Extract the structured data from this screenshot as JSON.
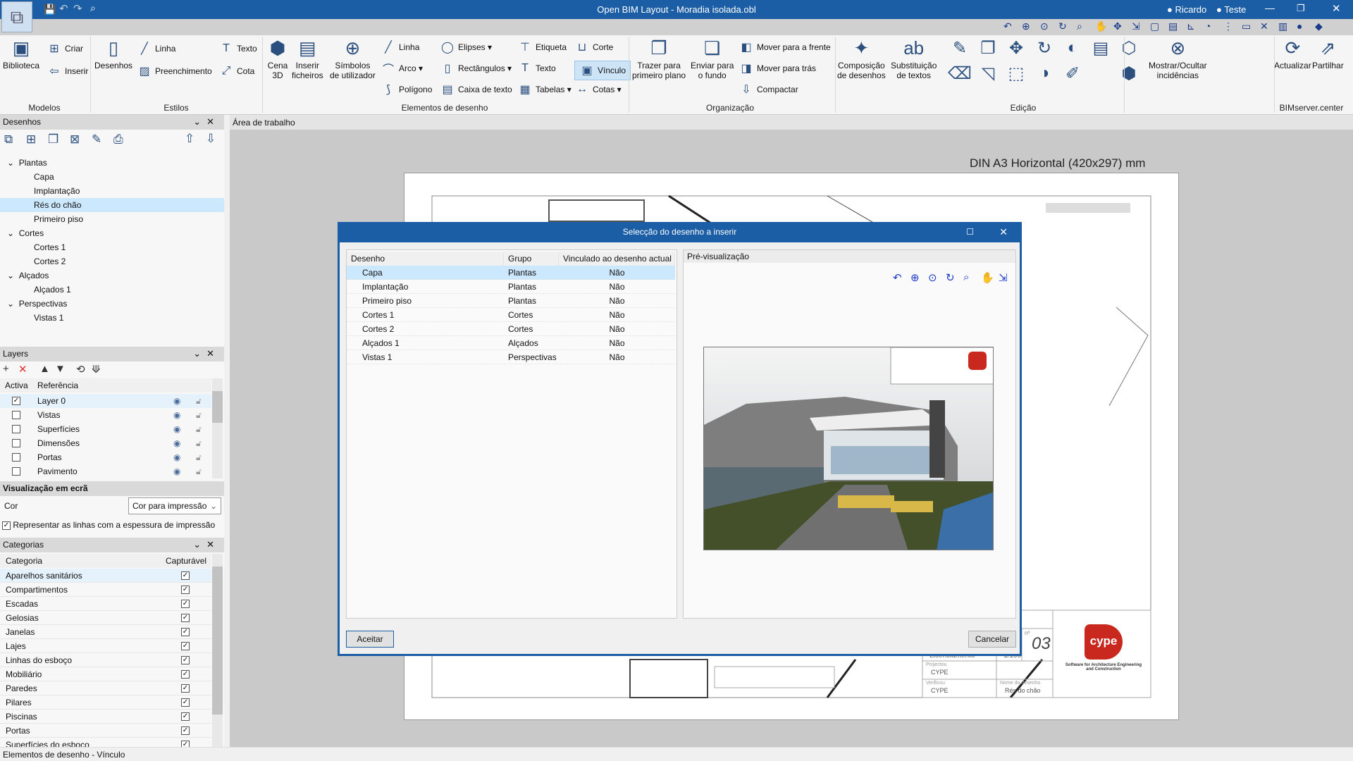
{
  "window": {
    "title": "Open BIM Layout - Moradia isolada.obl",
    "user1": "Ricardo",
    "user2": "Teste"
  },
  "ribbon": {
    "groups": [
      "Modelos",
      "Estilos",
      "Elementos de desenho",
      "Organização",
      "Edição",
      "BIMserver.center"
    ],
    "items": {
      "biblioteca": "Biblioteca",
      "criar": "Criar",
      "inserir": "Inserir",
      "desenhos": "Desenhos",
      "linha_estilo": "Linha",
      "preenchimento": "Preenchimento",
      "texto_estilo": "Texto",
      "cota": "Cota",
      "cena3d": "Cena\n3D",
      "inserir_ficheiros": "Inserir\nficheiros",
      "simbolos": "Símbolos\nde utilizador",
      "linha": "Linha",
      "arco": "Arco ▾",
      "poligono": "Polígono",
      "elipses": "Elipses ▾",
      "rectangulos": "Rectângulos ▾",
      "caixa_texto": "Caixa de texto",
      "etiqueta": "Etiqueta",
      "texto": "Texto",
      "tabelas": "Tabelas ▾",
      "corte": "Corte",
      "vinculo": "Vínculo",
      "cotas": "Cotas ▾",
      "trazer": "Trazer para\nprimeiro plano",
      "enviar": "Enviar para\no fundo",
      "mover_frente": "Mover para a frente",
      "mover_tras": "Mover para trás",
      "compactar": "Compactar",
      "composicao": "Composição\nde desenhos",
      "substituicao": "Substituição\nde textos",
      "mostrar": "Mostrar/Ocultar\nincidências",
      "actualizar": "Actualizar",
      "partilhar": "Partilhar"
    },
    "active_item": "vinculo"
  },
  "desenhos_panel": {
    "title": "Desenhos",
    "tree": [
      {
        "group": "Plantas",
        "items": [
          "Capa",
          "Implantação",
          "Rés do chão",
          "Primeiro piso"
        ]
      },
      {
        "group": "Cortes",
        "items": [
          "Cortes 1",
          "Cortes 2"
        ]
      },
      {
        "group": "Alçados",
        "items": [
          "Alçados 1"
        ]
      },
      {
        "group": "Perspectivas",
        "items": [
          "Vistas 1"
        ]
      }
    ],
    "selected": "Rés do chão"
  },
  "layers_panel": {
    "title": "Layers",
    "columns": [
      "Activa",
      "Referência"
    ],
    "rows": [
      {
        "name": "Layer 0",
        "active": true
      },
      {
        "name": "Vistas",
        "active": false
      },
      {
        "name": "Superfícies",
        "active": false
      },
      {
        "name": "Dimensões",
        "active": false
      },
      {
        "name": "Portas",
        "active": false
      },
      {
        "name": "Pavimento",
        "active": false
      }
    ]
  },
  "visualizacao": {
    "title": "Visualização em ecrã",
    "color_label": "Cor",
    "color_value": "Cor para impressão",
    "checkbox_label": "Representar as linhas com a espessura de impressão",
    "checkbox_checked": true
  },
  "categorias_panel": {
    "title": "Categorias",
    "columns": [
      "Categoria",
      "Capturável"
    ],
    "rows": [
      "Aparelhos sanitários",
      "Compartimentos",
      "Escadas",
      "Gelosias",
      "Janelas",
      "Lajes",
      "Linhas do esboço",
      "Mobiliário",
      "Paredes",
      "Pilares",
      "Piscinas",
      "Portas",
      "Superfícies do esboço"
    ]
  },
  "workspace": {
    "title": "Área de trabalho",
    "paper": "DIN A3   Horizontal (420x297) mm",
    "title_block": {
      "fase": "Licenciamento",
      "escala": "1/100",
      "numero_label": "nº",
      "numero": "03",
      "projectou_label": "Projectou",
      "projectou": "CYPE",
      "verificou_label": "Verificou",
      "verificou": "CYPE",
      "nome_label": "Nome do desenho",
      "nome": "Rés do chão",
      "logo": "cype",
      "logo_tagline": "Software for Architecture Engineering and Construction"
    }
  },
  "dialog": {
    "title": "Selecção do desenho a inserir",
    "columns": [
      "Desenho",
      "Grupo",
      "Vinculado ao desenho actual"
    ],
    "rows": [
      [
        "Capa",
        "Plantas",
        "Não"
      ],
      [
        "Implantação",
        "Plantas",
        "Não"
      ],
      [
        "Primeiro piso",
        "Plantas",
        "Não"
      ],
      [
        "Cortes 1",
        "Cortes",
        "Não"
      ],
      [
        "Cortes 2",
        "Cortes",
        "Não"
      ],
      [
        "Alçados 1",
        "Alçados",
        "Não"
      ],
      [
        "Vistas 1",
        "Perspectivas",
        "Não"
      ]
    ],
    "selected_row": 0,
    "preview_label": "Pré-visualização",
    "accept": "Aceitar",
    "cancel": "Cancelar"
  },
  "status_bar": "Elementos de desenho - Vínculo",
  "colors": {
    "accent": "#1b5ea6",
    "selection": "#cce8ff",
    "cype_red": "#c8281e"
  }
}
